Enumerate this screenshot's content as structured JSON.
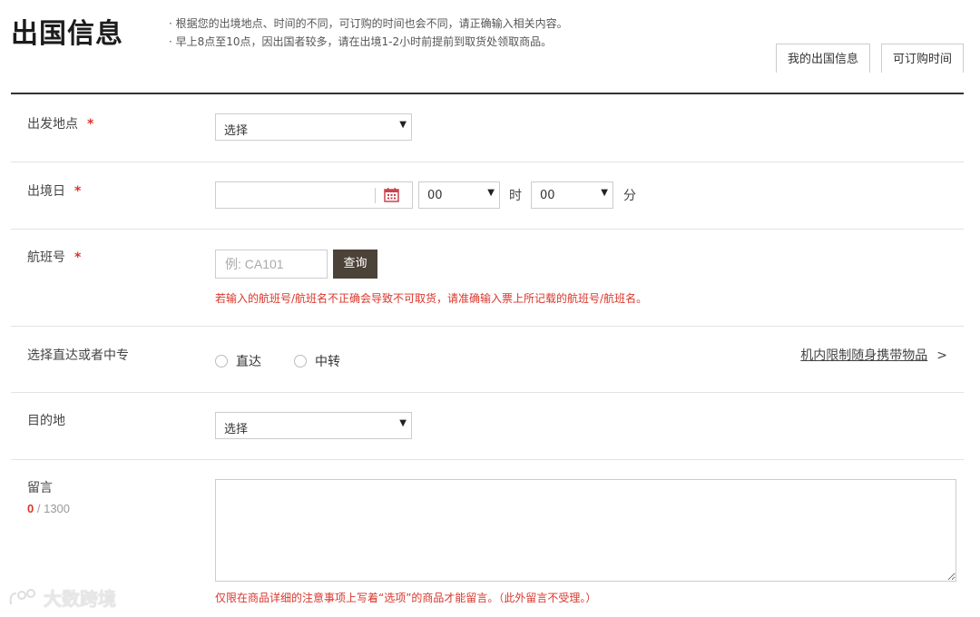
{
  "header": {
    "title": "出国信息",
    "notes": [
      "· 根据您的出境地点、时间的不同，可订购的时间也会不同，请正确输入相关内容。",
      "· 早上8点至10点，因出国者较多，请在出境1-2小时前提前到取货处领取商品。"
    ],
    "tabs": [
      "我的出国信息",
      "可订购时间"
    ]
  },
  "form": {
    "required_mark": "*",
    "departure": {
      "label": "出发地点",
      "value": "选择"
    },
    "exit_date": {
      "label": "出境日",
      "date_value": "",
      "hour": "00",
      "hour_unit": "时",
      "minute": "00",
      "minute_unit": "分"
    },
    "flight": {
      "label": "航班号",
      "placeholder": "例: CA101",
      "button": "查询",
      "warning": "若输入的航班号/航班名不正确会导致不可取货，请准确输入票上所记载的航班号/航班名。"
    },
    "route": {
      "label": "选择直达或者中专",
      "options": [
        "直达",
        "中转"
      ],
      "link": "机内限制随身携带物品"
    },
    "destination": {
      "label": "目的地",
      "value": "选择"
    },
    "message": {
      "label": "留言",
      "count": "0",
      "max": "/ 1300",
      "note": "仅限在商品详细的注意事项上写着“选项”的商品才能留言。（此外留言不受理。）"
    }
  },
  "watermark": "大数跨境"
}
